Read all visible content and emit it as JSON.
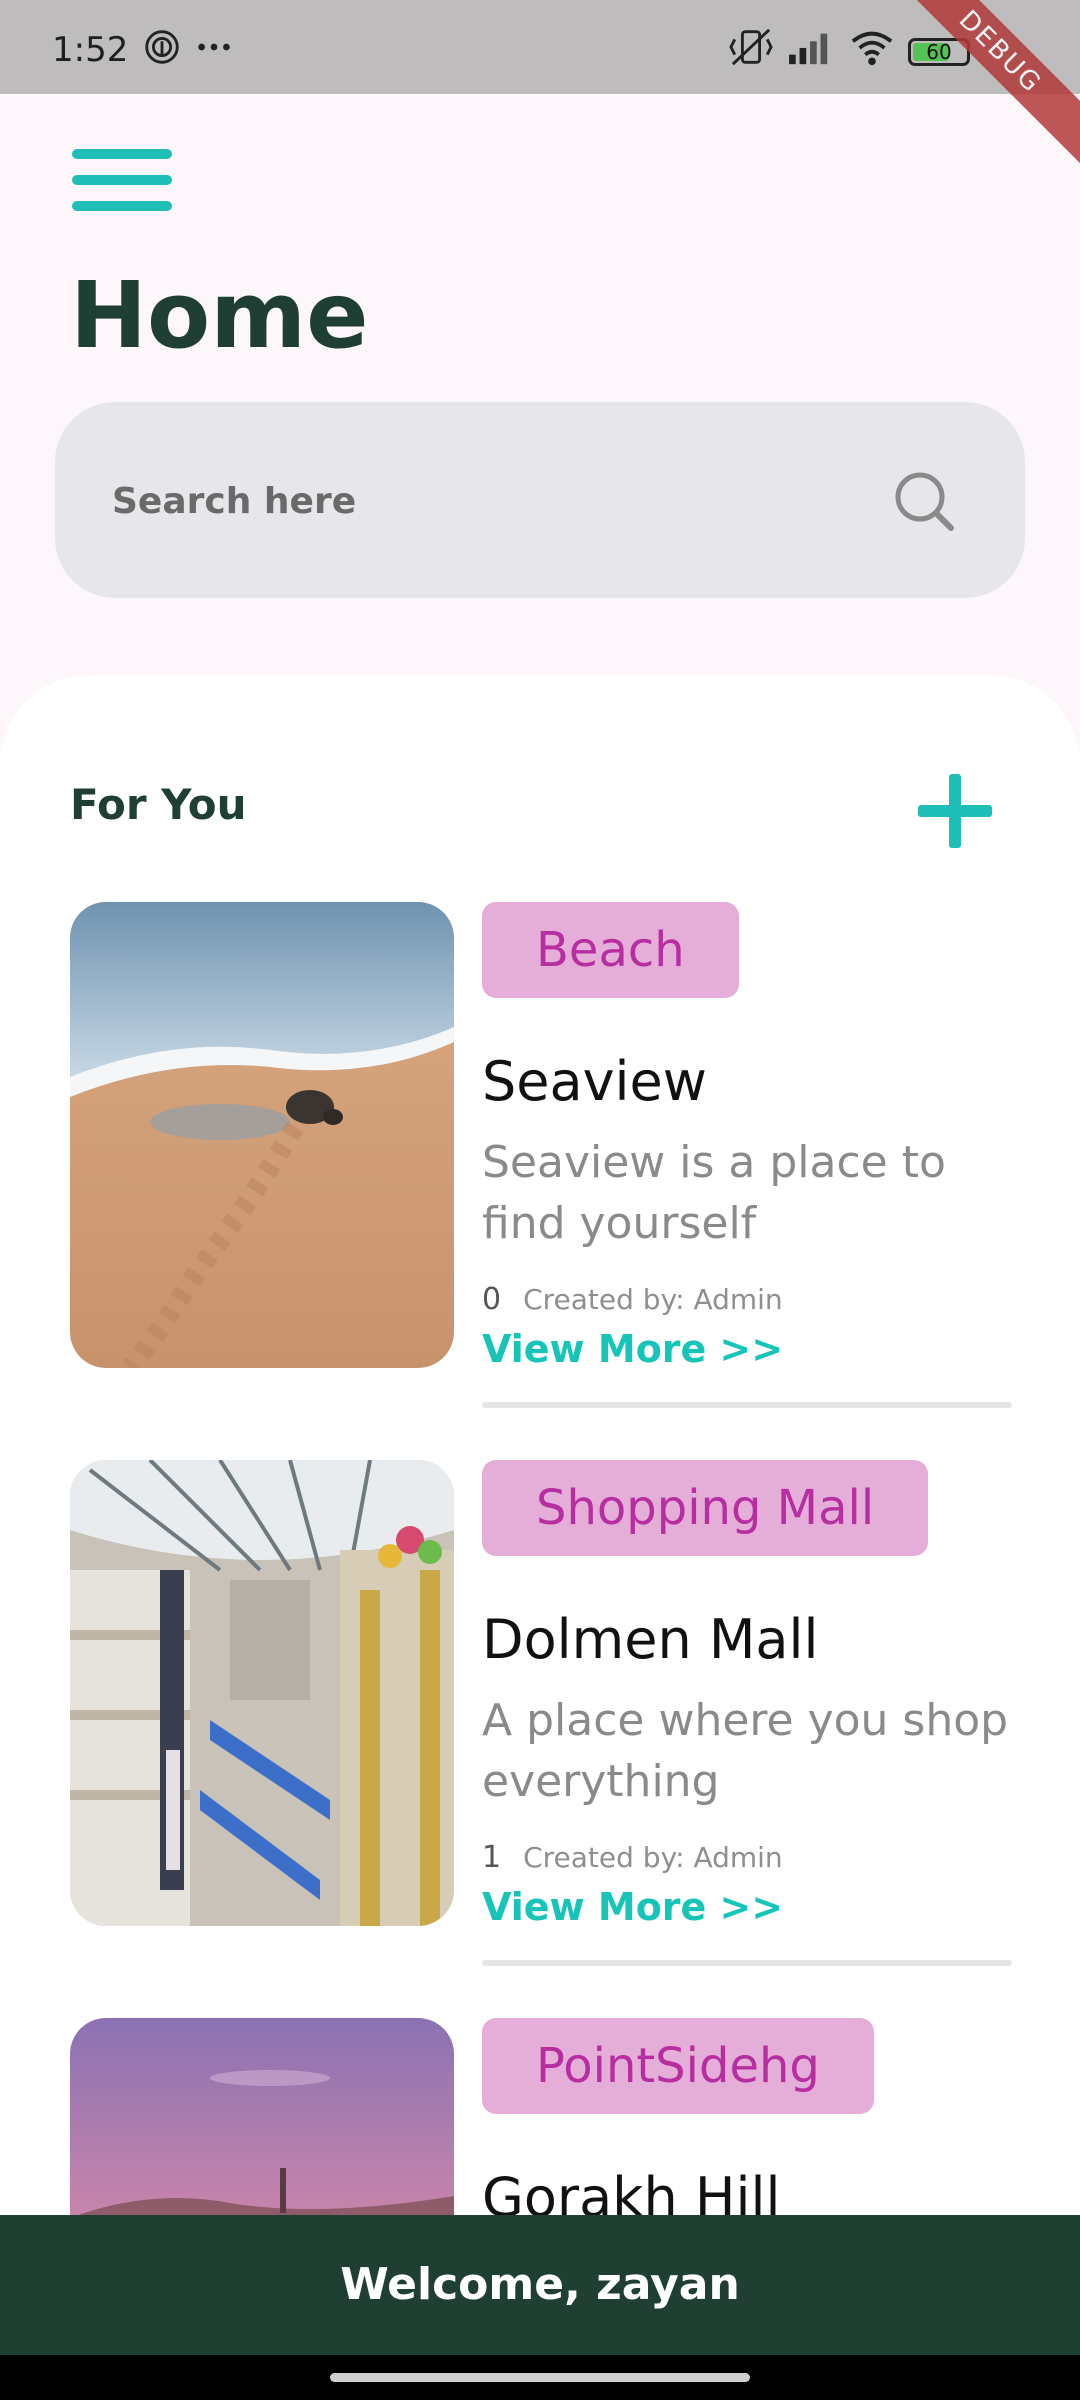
{
  "status_bar": {
    "time": "1:52",
    "battery": "60",
    "debug_label": "DEBUG"
  },
  "header": {
    "title": "Home"
  },
  "search": {
    "placeholder": "Search here"
  },
  "section": {
    "title": "For You"
  },
  "places": [
    {
      "category": "Beach",
      "name": "Seaview",
      "description": "Seaview is a place to find yourself",
      "count": "0",
      "created_by": "Created by: Admin",
      "view_more": "View More >>"
    },
    {
      "category": "Shopping Mall",
      "name": "Dolmen Mall",
      "description": "A place where you shop everything",
      "count": "1",
      "created_by": "Created by: Admin",
      "view_more": "View More >>"
    },
    {
      "category": "PointSidehg",
      "name": "Gorakh Hill"
    }
  ],
  "footer": {
    "welcome": "Welcome, zayan"
  },
  "colors": {
    "accent": "#1fbfb8",
    "dark_green": "#1e3f32",
    "chip_bg": "#e4aed9",
    "chip_text": "#b72ea1"
  }
}
